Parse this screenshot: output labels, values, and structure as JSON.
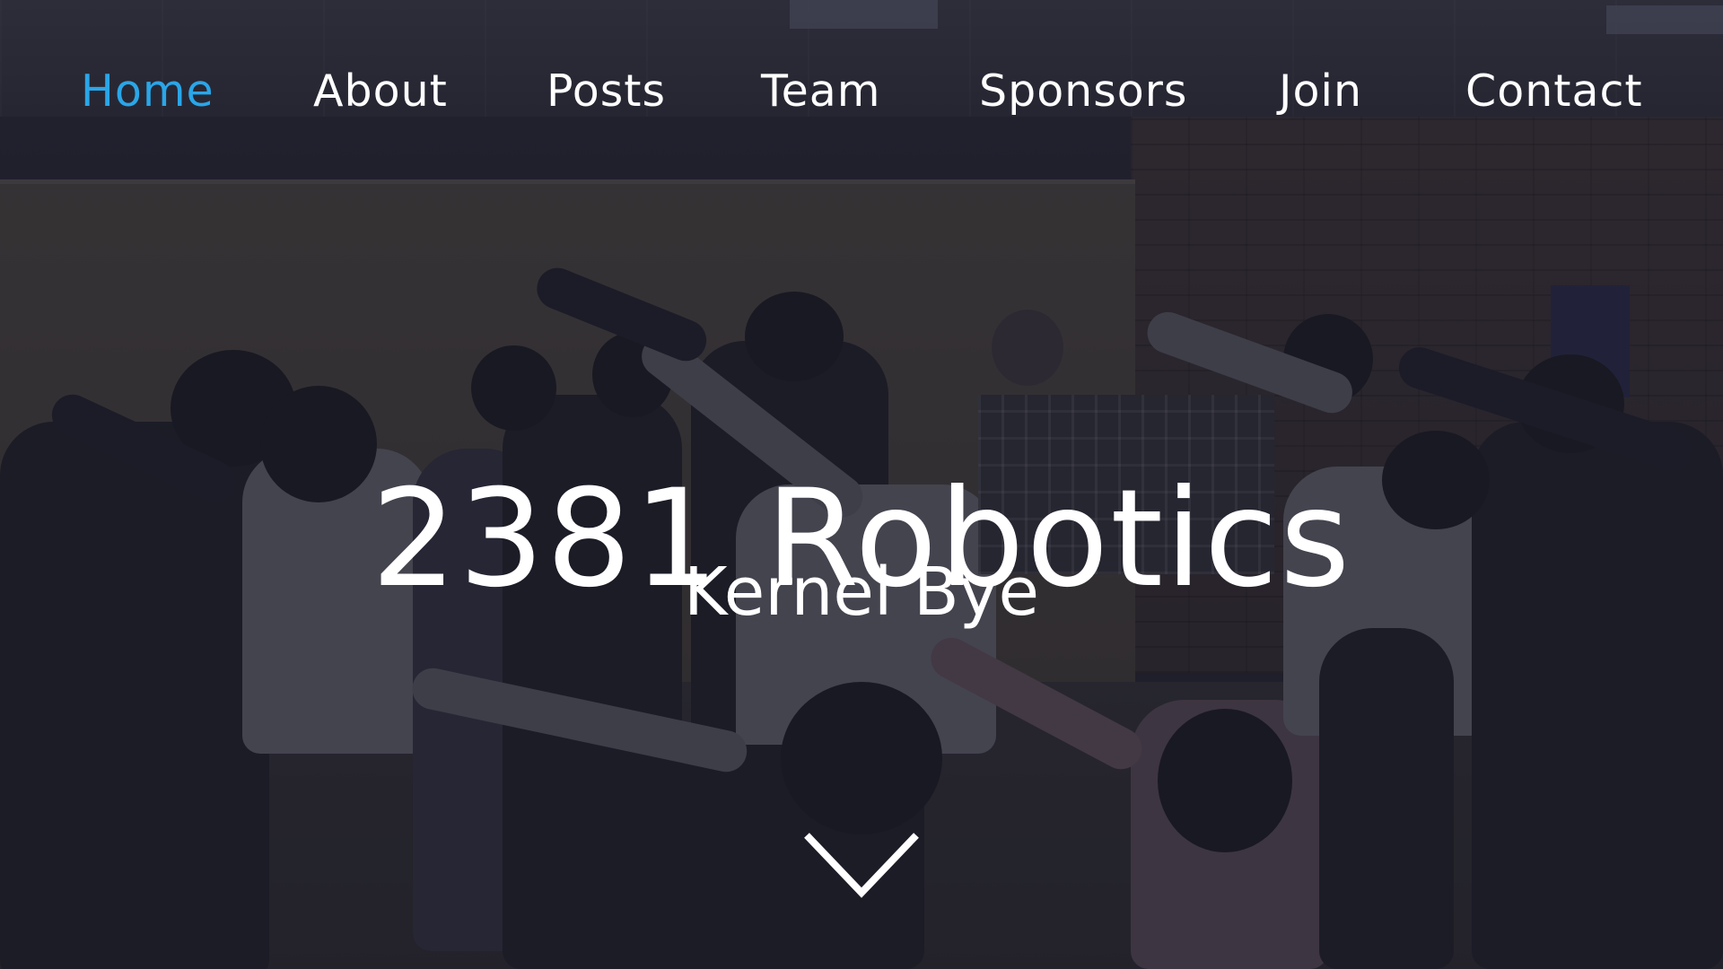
{
  "nav": {
    "items": [
      {
        "label": "Home",
        "active": true
      },
      {
        "label": "About",
        "active": false
      },
      {
        "label": "Posts",
        "active": false
      },
      {
        "label": "Team",
        "active": false
      },
      {
        "label": "Sponsors",
        "active": false
      },
      {
        "label": "Join",
        "active": false
      },
      {
        "label": "Contact",
        "active": false
      }
    ],
    "active_color": "#2aa6e8",
    "color": "#ffffff"
  },
  "hero": {
    "title": "2381 Robotics",
    "subtitle": "Kernel Bye",
    "scroll_icon": "chevron-down-icon",
    "background_image": "team-dab-photo"
  }
}
